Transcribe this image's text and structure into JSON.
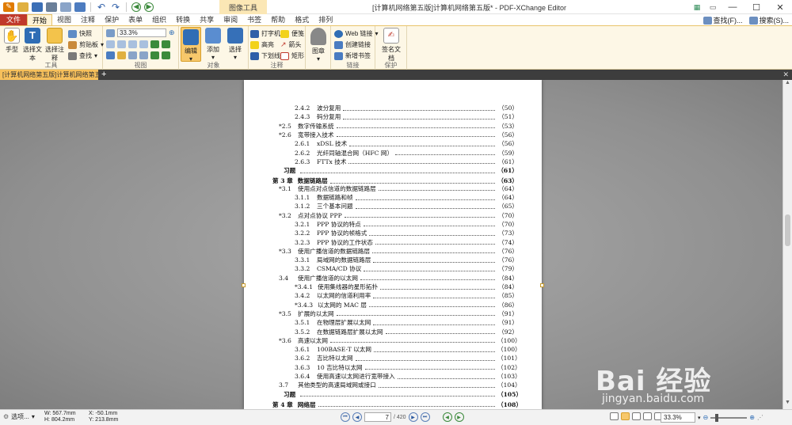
{
  "window": {
    "title": "[计算机网络第五版]计算机网络第五版* - PDF-XChange Editor",
    "context_tab_label": "图像工具"
  },
  "tabs": [
    "文件",
    "开始",
    "视图",
    "注释",
    "保护",
    "表单",
    "组织",
    "转换",
    "共享",
    "审阅",
    "书签",
    "帮助",
    "格式",
    "排列"
  ],
  "active_tab": "开始",
  "find": {
    "find_label": "查找(F)...",
    "search_label": "搜索(S)..."
  },
  "ribbon": {
    "tools_group": {
      "label": "工具",
      "hand": "手型",
      "select_text": "选择文本",
      "select_annot": "选择注释",
      "snapshot": "快照",
      "clipboard": "剪贴板",
      "find": "查找"
    },
    "view_group": {
      "label": "视图",
      "zoom": "33.3%"
    },
    "objects_group": {
      "label": "对象",
      "edit": "编辑",
      "add": "添加",
      "select": "选择"
    },
    "annot_group": {
      "label": "注释",
      "typewriter": "打字机",
      "sticky": "便笺",
      "highlight": "高亮",
      "arrow": "箭头",
      "underline": "下划线",
      "rect": "矩形"
    },
    "stamp_group": {
      "stamp": "图章"
    },
    "links_group": {
      "label": "链接",
      "web_link": "Web 链接",
      "create_link": "创建链接",
      "new_bookmark": "新增书签"
    },
    "protect_group": {
      "label": "保护",
      "sign": "签名文档"
    }
  },
  "document_tab": {
    "label": "[计算机网络第五版]计算机网络第五版 *"
  },
  "toc": [
    {
      "num": "2.4.2",
      "title": "波分复用",
      "page": "（50）",
      "level": 2
    },
    {
      "num": "2.4.3",
      "title": "码分复用",
      "page": "（51）",
      "level": 2
    },
    {
      "num": "*2.5",
      "title": "数字传输系统",
      "page": "（53）",
      "level": 1
    },
    {
      "num": "*2.6",
      "title": "宽带接入技术",
      "page": "（56）",
      "level": 1
    },
    {
      "num": "2.6.1",
      "title": "xDSL 技术",
      "page": "（56）",
      "level": 2
    },
    {
      "num": "2.6.2",
      "title": "光纤同轴混合网（HFC 网）",
      "page": "（59）",
      "level": 2
    },
    {
      "num": "2.6.3",
      "title": "FTTx 技术",
      "page": "（61）",
      "level": 2
    },
    {
      "num": "习题",
      "title": "",
      "page": "（61）",
      "level": 0
    },
    {
      "num": "第 3 章",
      "title": "数据链路层",
      "page": "（63）",
      "level": -1
    },
    {
      "num": "*3.1",
      "title": "使用点对点信道的数据链路层",
      "page": "（64）",
      "level": 1
    },
    {
      "num": "3.1.1",
      "title": "数据链路和帧",
      "page": "（64）",
      "level": 2
    },
    {
      "num": "3.1.2",
      "title": "三个基本问题",
      "page": "（65）",
      "level": 2
    },
    {
      "num": "*3.2",
      "title": "点对点协议 PPP",
      "page": "（70）",
      "level": 1
    },
    {
      "num": "3.2.1",
      "title": "PPP 协议的特点",
      "page": "（70）",
      "level": 2
    },
    {
      "num": "3.2.2",
      "title": "PPP 协议的帧格式",
      "page": "（73）",
      "level": 2
    },
    {
      "num": "3.2.3",
      "title": "PPP 协议的工作状态",
      "page": "（74）",
      "level": 2
    },
    {
      "num": "*3.3",
      "title": "使用广播信道的数据链路层",
      "page": "（76）",
      "level": 1
    },
    {
      "num": "3.3.1",
      "title": "局域网的数据链路层",
      "page": "（76）",
      "level": 2
    },
    {
      "num": "3.3.2",
      "title": "CSMA/CD 协议",
      "page": "（79）",
      "level": 2
    },
    {
      "num": "3.4",
      "title": "使用广播信道的以太网",
      "page": "（84）",
      "level": 1
    },
    {
      "num": "*3.4.1",
      "title": "使用集线器的星形拓扑",
      "page": "（84）",
      "level": 2
    },
    {
      "num": "3.4.2",
      "title": "以太网的信道利用率",
      "page": "（85）",
      "level": 2
    },
    {
      "num": "*3.4.3",
      "title": "以太网的 MAC 层",
      "page": "（86）",
      "level": 2
    },
    {
      "num": "*3.5",
      "title": "扩展的以太网",
      "page": "（91）",
      "level": 1
    },
    {
      "num": "3.5.1",
      "title": "在物理层扩展以太网",
      "page": "（91）",
      "level": 2
    },
    {
      "num": "3.5.2",
      "title": "在数据链路层扩展以太网",
      "page": "（92）",
      "level": 2
    },
    {
      "num": "*3.6",
      "title": "高速以太网",
      "page": "（100）",
      "level": 1
    },
    {
      "num": "3.6.1",
      "title": "100BASE-T 以太网",
      "page": "（100）",
      "level": 2
    },
    {
      "num": "3.6.2",
      "title": "吉比特以太网",
      "page": "（101）",
      "level": 2
    },
    {
      "num": "3.6.3",
      "title": "10 吉比特以太网",
      "page": "（102）",
      "level": 2
    },
    {
      "num": "3.6.4",
      "title": "使用高速以太网进行宽带接入",
      "page": "（103）",
      "level": 2
    },
    {
      "num": "3.7",
      "title": "其他类型的高速局域网或接口",
      "page": "（104）",
      "level": 1
    },
    {
      "num": "习题",
      "title": "",
      "page": "（105）",
      "level": 0
    },
    {
      "num": "第 4 章",
      "title": "网络层",
      "page": "（108）",
      "level": -1
    }
  ],
  "status": {
    "options": "选项...",
    "width": "W: 567.7mm",
    "height": "H: 804.2mm",
    "x": "X: -50.1mm",
    "y": "Y: 213.8mm",
    "page_current": "7",
    "page_total": "/ 420",
    "zoom": "33.3%"
  },
  "watermark": {
    "brand": "Bai 经验",
    "url": "jingyan.baidu.com"
  }
}
